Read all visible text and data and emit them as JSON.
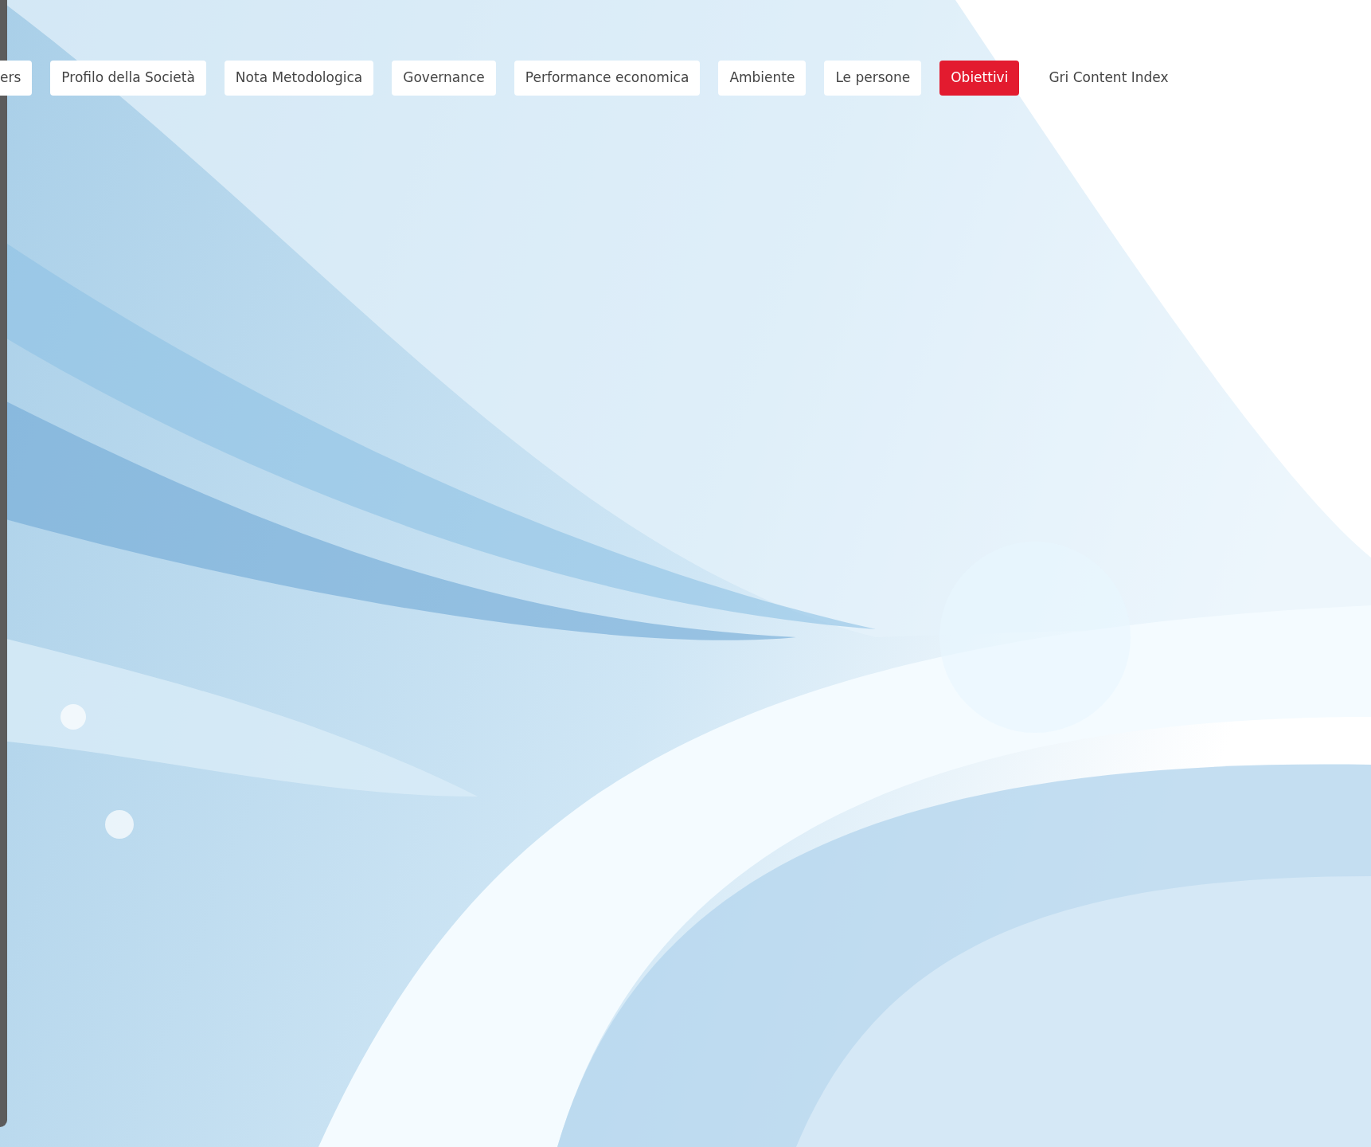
{
  "tabs": [
    {
      "label": "ers",
      "selected": false
    },
    {
      "label": "Profilo della Società",
      "selected": false
    },
    {
      "label": "Nota Metodologica",
      "selected": false
    },
    {
      "label": "Governance",
      "selected": false
    },
    {
      "label": "Performance economica",
      "selected": false
    },
    {
      "label": "Ambiente",
      "selected": false
    },
    {
      "label": "Le persone",
      "selected": false
    },
    {
      "label": "Obiettivi",
      "selected": true
    },
    {
      "label": "Gri Content Index",
      "selected": false
    }
  ]
}
